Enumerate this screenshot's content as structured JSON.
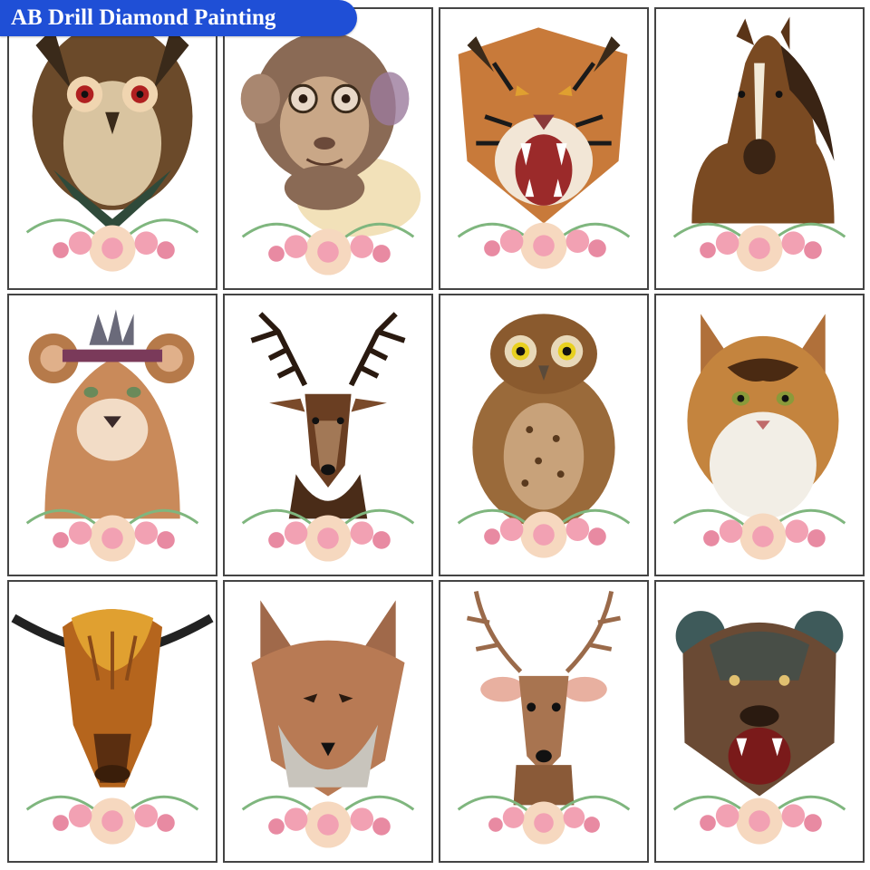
{
  "badge": {
    "text": "AB Drill Diamond Painting"
  },
  "colors": {
    "badge_bg": "#1f4fd6",
    "frame_border": "#444444",
    "rose_pink": "#f2a1b3",
    "rose_cream": "#f6d8bf",
    "leaf_green": "#7fb67e"
  },
  "paintings": [
    {
      "subject": "owl-geometric",
      "icon": "owl-icon"
    },
    {
      "subject": "monkey-glasses",
      "icon": "monkey-icon"
    },
    {
      "subject": "tiger-roaring",
      "icon": "tiger-icon"
    },
    {
      "subject": "horse",
      "icon": "horse-icon"
    },
    {
      "subject": "lion-cub-feathers",
      "icon": "lion-cub-icon"
    },
    {
      "subject": "deer-stag-dark",
      "icon": "stag-icon"
    },
    {
      "subject": "owl-brown",
      "icon": "owl-icon"
    },
    {
      "subject": "cat-maine-coon",
      "icon": "cat-icon"
    },
    {
      "subject": "highland-cow",
      "icon": "cow-icon"
    },
    {
      "subject": "fox",
      "icon": "fox-icon"
    },
    {
      "subject": "deer-light",
      "icon": "deer-icon"
    },
    {
      "subject": "bear-roaring",
      "icon": "bear-icon"
    }
  ]
}
